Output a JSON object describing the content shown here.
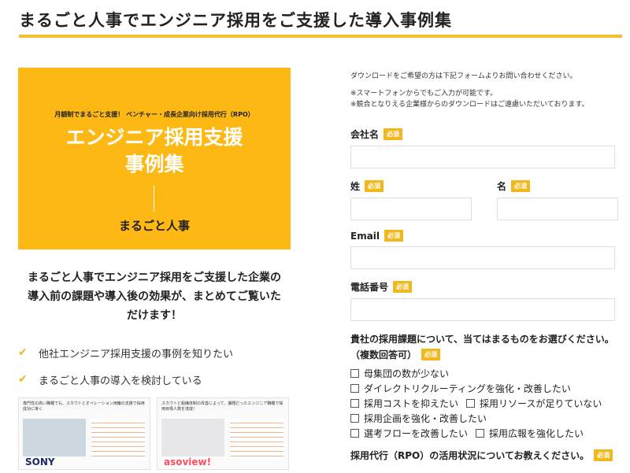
{
  "page": {
    "title": "まるごと人事でエンジニア採用をご支援した導入事例集",
    "accent_color": "#f2c02e"
  },
  "cover": {
    "tagline": "月額制でまるごと支援！ ベンチャー・成長企業向け採用代行（RPO）",
    "heading_line1": "エンジニア採用支援",
    "heading_line2": "事例集",
    "brand": "まるごと人事",
    "bg_color": "#fdb813"
  },
  "lead": {
    "line1": "まるごと人事でエンジニア採用をご支援した企業の",
    "line2": "導入前の課題や導入後の効果が、まとめてご覧いた",
    "line3": "だけます！"
  },
  "checks": [
    {
      "text": "他社エンジニア採用支援の事例を知りたい"
    },
    {
      "text": "まるごと人事の導入を検討している"
    }
  ],
  "thumbs": [
    {
      "title": "専門性の高い職種でも、スカウトとオペレーション両輪の支援で採用成功に導く",
      "logo": "SONY"
    },
    {
      "title": "スカウトと組織体制の改善によって、課題だったエンジニア職種で採用目標人数を達成！",
      "logo": "asoview!"
    }
  ],
  "form": {
    "notes": [
      "ダウンロードをご希望の方は下記フォームよりお問い合わせください。",
      "※スマートフォンからでもご入力が可能です。",
      "※競合となりえる企業様からのダウンロードはご遠慮いただいております。"
    ],
    "required_label": "必須",
    "company_label": "会社名",
    "last_name_label": "姓",
    "first_name_label": "名",
    "email_label": "Email",
    "phone_label": "電話番号",
    "issues_label_line1": "貴社の採用課題について、当てはまるものをお選びください。",
    "issues_label_line2": "（複数回答可）",
    "issues": [
      "母集団の数が少ない",
      "ダイレクトリクルーティングを強化・改善したい",
      "採用コストを抑えたい",
      "採用リソースが足りていない",
      "採用企画を強化・改善したい",
      "選考フローを改善したい",
      "採用広報を強化したい"
    ],
    "rpo_label": "採用代行（RPO）の活用状況についてお教えください。"
  }
}
